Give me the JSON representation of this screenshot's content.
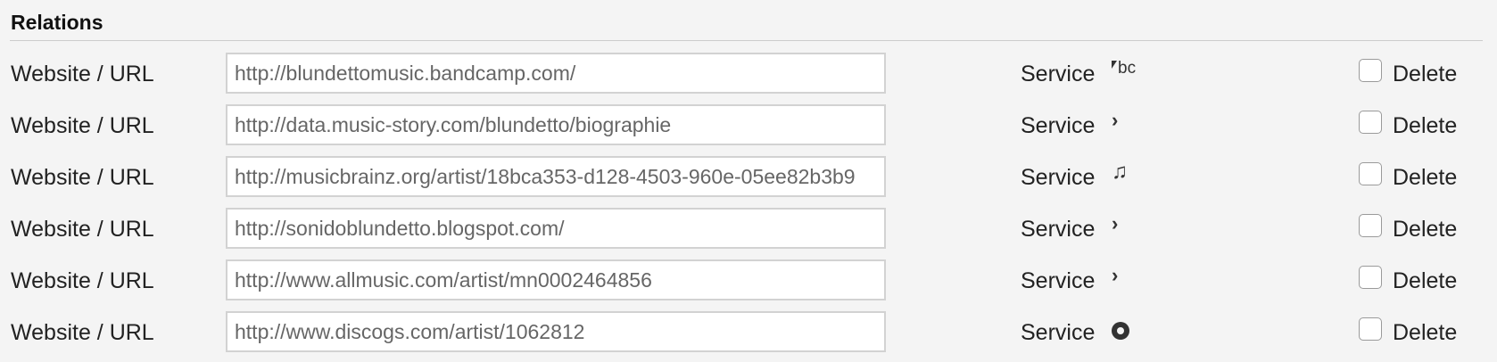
{
  "section": {
    "title": "Relations"
  },
  "relations": [
    {
      "label": "Website / URL",
      "url": "http://blundettomusic.bandcamp.com/",
      "service_label": "Service",
      "service_icon": "bandcamp-icon",
      "delete_label": "Delete",
      "delete_checked": false
    },
    {
      "label": "Website / URL",
      "url": "http://data.music-story.com/blundetto/biographie",
      "service_label": "Service",
      "service_icon": "chevron-right-icon",
      "delete_label": "Delete",
      "delete_checked": false
    },
    {
      "label": "Website / URL",
      "url": "http://musicbrainz.org/artist/18bca353-d128-4503-960e-05ee82b3b9",
      "service_label": "Service",
      "service_icon": "music-note-icon",
      "delete_label": "Delete",
      "delete_checked": false
    },
    {
      "label": "Website / URL",
      "url": "http://sonidoblundetto.blogspot.com/",
      "service_label": "Service",
      "service_icon": "chevron-right-icon",
      "delete_label": "Delete",
      "delete_checked": false
    },
    {
      "label": "Website / URL",
      "url": "http://www.allmusic.com/artist/mn0002464856",
      "service_label": "Service",
      "service_icon": "chevron-right-icon",
      "delete_label": "Delete",
      "delete_checked": false
    },
    {
      "label": "Website / URL",
      "url": "http://www.discogs.com/artist/1062812",
      "service_label": "Service",
      "service_icon": "discogs-icon",
      "delete_label": "Delete",
      "delete_checked": false
    }
  ],
  "icons": {
    "bandcamp_text": "bc",
    "chevron_glyph": "›",
    "note_glyph": "♫"
  }
}
